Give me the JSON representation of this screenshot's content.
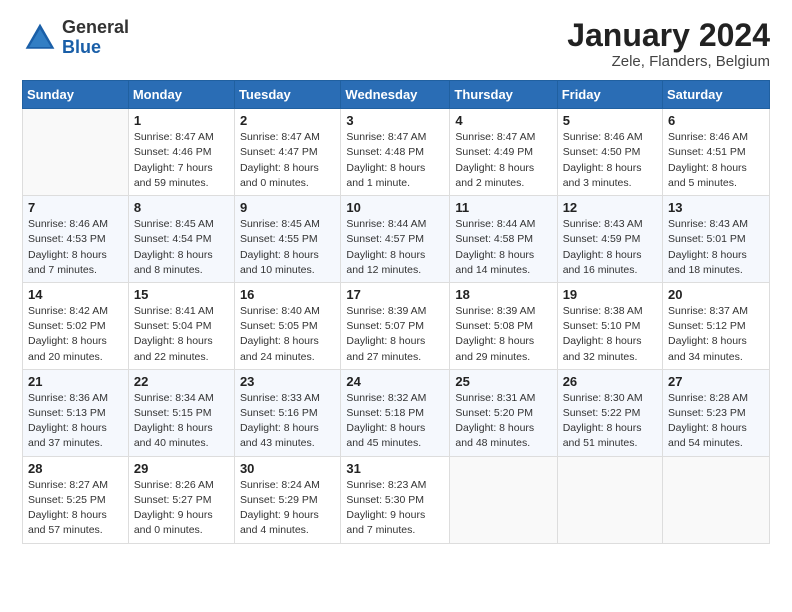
{
  "header": {
    "logo_general": "General",
    "logo_blue": "Blue",
    "month_year": "January 2024",
    "location": "Zele, Flanders, Belgium"
  },
  "weekdays": [
    "Sunday",
    "Monday",
    "Tuesday",
    "Wednesday",
    "Thursday",
    "Friday",
    "Saturday"
  ],
  "weeks": [
    [
      {
        "day": "",
        "detail": ""
      },
      {
        "day": "1",
        "detail": "Sunrise: 8:47 AM\nSunset: 4:46 PM\nDaylight: 7 hours\nand 59 minutes."
      },
      {
        "day": "2",
        "detail": "Sunrise: 8:47 AM\nSunset: 4:47 PM\nDaylight: 8 hours\nand 0 minutes."
      },
      {
        "day": "3",
        "detail": "Sunrise: 8:47 AM\nSunset: 4:48 PM\nDaylight: 8 hours\nand 1 minute."
      },
      {
        "day": "4",
        "detail": "Sunrise: 8:47 AM\nSunset: 4:49 PM\nDaylight: 8 hours\nand 2 minutes."
      },
      {
        "day": "5",
        "detail": "Sunrise: 8:46 AM\nSunset: 4:50 PM\nDaylight: 8 hours\nand 3 minutes."
      },
      {
        "day": "6",
        "detail": "Sunrise: 8:46 AM\nSunset: 4:51 PM\nDaylight: 8 hours\nand 5 minutes."
      }
    ],
    [
      {
        "day": "7",
        "detail": "Sunrise: 8:46 AM\nSunset: 4:53 PM\nDaylight: 8 hours\nand 7 minutes."
      },
      {
        "day": "8",
        "detail": "Sunrise: 8:45 AM\nSunset: 4:54 PM\nDaylight: 8 hours\nand 8 minutes."
      },
      {
        "day": "9",
        "detail": "Sunrise: 8:45 AM\nSunset: 4:55 PM\nDaylight: 8 hours\nand 10 minutes."
      },
      {
        "day": "10",
        "detail": "Sunrise: 8:44 AM\nSunset: 4:57 PM\nDaylight: 8 hours\nand 12 minutes."
      },
      {
        "day": "11",
        "detail": "Sunrise: 8:44 AM\nSunset: 4:58 PM\nDaylight: 8 hours\nand 14 minutes."
      },
      {
        "day": "12",
        "detail": "Sunrise: 8:43 AM\nSunset: 4:59 PM\nDaylight: 8 hours\nand 16 minutes."
      },
      {
        "day": "13",
        "detail": "Sunrise: 8:43 AM\nSunset: 5:01 PM\nDaylight: 8 hours\nand 18 minutes."
      }
    ],
    [
      {
        "day": "14",
        "detail": "Sunrise: 8:42 AM\nSunset: 5:02 PM\nDaylight: 8 hours\nand 20 minutes."
      },
      {
        "day": "15",
        "detail": "Sunrise: 8:41 AM\nSunset: 5:04 PM\nDaylight: 8 hours\nand 22 minutes."
      },
      {
        "day": "16",
        "detail": "Sunrise: 8:40 AM\nSunset: 5:05 PM\nDaylight: 8 hours\nand 24 minutes."
      },
      {
        "day": "17",
        "detail": "Sunrise: 8:39 AM\nSunset: 5:07 PM\nDaylight: 8 hours\nand 27 minutes."
      },
      {
        "day": "18",
        "detail": "Sunrise: 8:39 AM\nSunset: 5:08 PM\nDaylight: 8 hours\nand 29 minutes."
      },
      {
        "day": "19",
        "detail": "Sunrise: 8:38 AM\nSunset: 5:10 PM\nDaylight: 8 hours\nand 32 minutes."
      },
      {
        "day": "20",
        "detail": "Sunrise: 8:37 AM\nSunset: 5:12 PM\nDaylight: 8 hours\nand 34 minutes."
      }
    ],
    [
      {
        "day": "21",
        "detail": "Sunrise: 8:36 AM\nSunset: 5:13 PM\nDaylight: 8 hours\nand 37 minutes."
      },
      {
        "day": "22",
        "detail": "Sunrise: 8:34 AM\nSunset: 5:15 PM\nDaylight: 8 hours\nand 40 minutes."
      },
      {
        "day": "23",
        "detail": "Sunrise: 8:33 AM\nSunset: 5:16 PM\nDaylight: 8 hours\nand 43 minutes."
      },
      {
        "day": "24",
        "detail": "Sunrise: 8:32 AM\nSunset: 5:18 PM\nDaylight: 8 hours\nand 45 minutes."
      },
      {
        "day": "25",
        "detail": "Sunrise: 8:31 AM\nSunset: 5:20 PM\nDaylight: 8 hours\nand 48 minutes."
      },
      {
        "day": "26",
        "detail": "Sunrise: 8:30 AM\nSunset: 5:22 PM\nDaylight: 8 hours\nand 51 minutes."
      },
      {
        "day": "27",
        "detail": "Sunrise: 8:28 AM\nSunset: 5:23 PM\nDaylight: 8 hours\nand 54 minutes."
      }
    ],
    [
      {
        "day": "28",
        "detail": "Sunrise: 8:27 AM\nSunset: 5:25 PM\nDaylight: 8 hours\nand 57 minutes."
      },
      {
        "day": "29",
        "detail": "Sunrise: 8:26 AM\nSunset: 5:27 PM\nDaylight: 9 hours\nand 0 minutes."
      },
      {
        "day": "30",
        "detail": "Sunrise: 8:24 AM\nSunset: 5:29 PM\nDaylight: 9 hours\nand 4 minutes."
      },
      {
        "day": "31",
        "detail": "Sunrise: 8:23 AM\nSunset: 5:30 PM\nDaylight: 9 hours\nand 7 minutes."
      },
      {
        "day": "",
        "detail": ""
      },
      {
        "day": "",
        "detail": ""
      },
      {
        "day": "",
        "detail": ""
      }
    ]
  ]
}
